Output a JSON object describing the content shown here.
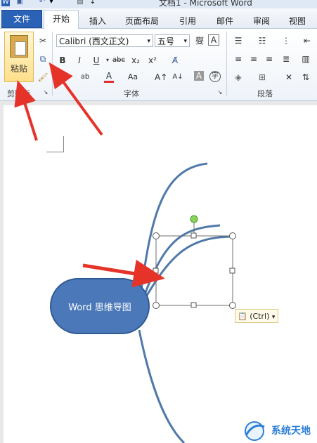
{
  "window": {
    "title": "文档1 - Microsoft Word"
  },
  "tabs": [
    "文件",
    "开始",
    "插入",
    "页面布局",
    "引用",
    "邮件",
    "审阅",
    "视图"
  ],
  "clipboard": {
    "paste_label": "粘贴",
    "group_label": "剪贴板"
  },
  "font": {
    "name": "Calibri (西文正文)",
    "size": "五号",
    "group_label": "字体"
  },
  "paragraph": {
    "group_label": "段落"
  },
  "mindmap": {
    "center_label": "Word 思维导图"
  },
  "paste_options": {
    "label": "(Ctrl)"
  },
  "watermark": {
    "text": "系统天地"
  },
  "colors": {
    "node_fill": "#4a78b8",
    "node_border": "#2f5a93",
    "branch": "#4f79a8",
    "arrow": "#e5332a",
    "file_tab": "#2a62b6"
  }
}
